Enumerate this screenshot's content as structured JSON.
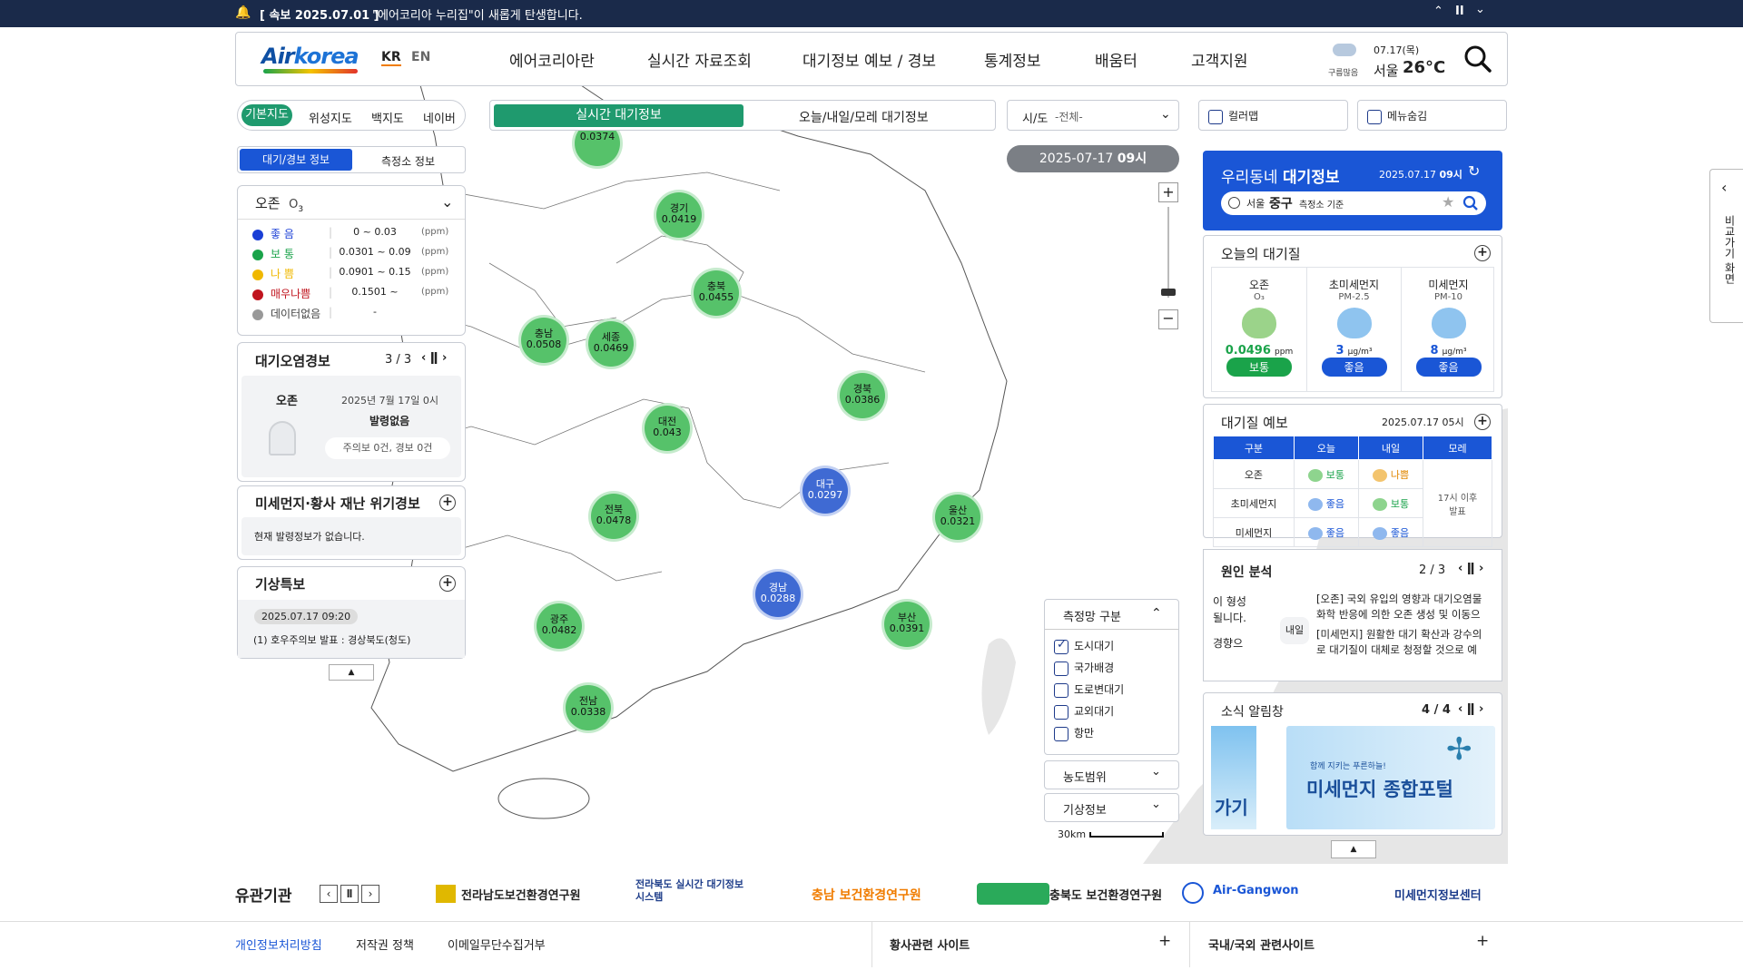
{
  "top_notice": {
    "tag": "[ 속보 2025.07.01 ]",
    "text": "\"에어코리아 누리집\"이 새롭게 탄생합니다."
  },
  "header": {
    "logo": {
      "air": "Air",
      "korea": "korea"
    },
    "lang_kr": "KR",
    "lang_en": "EN",
    "nav": [
      "에어코리아란",
      "실시간 자료조회",
      "대기정보 예보 / 경보",
      "통계정보",
      "배움터",
      "고객지원"
    ],
    "weather": {
      "date": "07.17(목)",
      "sky": "구름많음",
      "city": "서울",
      "temp": "26°C"
    }
  },
  "map_controls": {
    "base_tabs": [
      "기본지도",
      "위성지도",
      "백지도",
      "네이버"
    ],
    "info_tabs": [
      "대기/경보 정보",
      "측정소 정보"
    ],
    "center_tabs": [
      "실시간 대기정보",
      "오늘/내일/모레 대기정보"
    ],
    "sido_label": "시/도",
    "sido_value": "-전체-",
    "colormap": "컬러맵",
    "hide_menu": "메뉴숨김",
    "timestamp": "2025-07-17",
    "timestamp_hour": "09시"
  },
  "legend": {
    "title": "오존",
    "formula": "O",
    "sub": "3",
    "items": [
      {
        "label": "좋 음",
        "range": "0 ~ 0.03",
        "unit": "(ppm)",
        "color": "#1a3fd6"
      },
      {
        "label": "보 통",
        "range": "0.0301 ~ 0.09",
        "unit": "(ppm)",
        "color": "#1aa34a"
      },
      {
        "label": "나 쁨",
        "range": "0.0901 ~ 0.15",
        "unit": "(ppm)",
        "color": "#f0b800"
      },
      {
        "label": "매우나쁨",
        "range": "0.1501 ~",
        "unit": "(ppm)",
        "color": "#c0141e"
      },
      {
        "label": "데이터없음",
        "range": "-",
        "unit": "",
        "color": "#999999"
      }
    ]
  },
  "pollution_alert": {
    "title": "대기오염경보",
    "page": "3 / 3",
    "item": "오존",
    "date": "2025년 7월 17일 0시",
    "status": "발령없음",
    "counts": "주의보 0건, 경보 0건"
  },
  "dust_crisis": {
    "title": "미세먼지·황사 재난 위기경보",
    "text": "현재 발령정보가 없습니다."
  },
  "weather_alert": {
    "title": "기상특보",
    "time": "2025.07.17 09:20",
    "text": "(1) 호우주의보 발표 : 경상북도(청도)"
  },
  "markers": [
    {
      "name": "경기",
      "value": "0.0419",
      "c": "g"
    },
    {
      "name": "충북",
      "value": "0.0455",
      "c": "g"
    },
    {
      "name": "충남",
      "value": "0.0508",
      "c": "g"
    },
    {
      "name": "세종",
      "value": "0.0469",
      "c": "g"
    },
    {
      "name": "경북",
      "value": "0.0386",
      "c": "g"
    },
    {
      "name": "대전",
      "value": "0.043",
      "c": "g"
    },
    {
      "name": "대구",
      "value": "0.0297",
      "c": "b"
    },
    {
      "name": "전북",
      "value": "0.0478",
      "c": "g"
    },
    {
      "name": "울산",
      "value": "0.0321",
      "c": "g"
    },
    {
      "name": "경남",
      "value": "0.0288",
      "c": "b"
    },
    {
      "name": "부산",
      "value": "0.0391",
      "c": "g"
    },
    {
      "name": "광주",
      "value": "0.0482",
      "c": "g"
    },
    {
      "name": "전남",
      "value": "0.0338",
      "c": "g"
    },
    {
      "name": "",
      "value": "0.0374",
      "c": "g"
    }
  ],
  "network": {
    "title": "측정망 구분",
    "items": [
      {
        "label": "도시대기",
        "checked": true
      },
      {
        "label": "국가배경",
        "checked": false
      },
      {
        "label": "도로변대기",
        "checked": false
      },
      {
        "label": "교외대기",
        "checked": false
      },
      {
        "label": "항만",
        "checked": false
      }
    ],
    "range": "농도범위",
    "weather": "기상정보",
    "scale": "30km"
  },
  "side": {
    "tab": "비교가기 화면"
  },
  "right": {
    "local": {
      "title_a": "우리동네 ",
      "title_b": "대기정보",
      "date": "2025.07.17",
      "hour": "09시",
      "city": "서울",
      "district": "중구",
      "suffix": "측정소 기준"
    },
    "today": {
      "title": "오늘의 대기질",
      "cols": [
        {
          "name": "오존",
          "sub": "O₃",
          "value": "0.0496",
          "unit": "ppm",
          "grade": "보통",
          "color": "#1aa34a"
        },
        {
          "name": "초미세먼지",
          "sub": "PM-2.5",
          "value": "3",
          "unit": "μg/m³",
          "grade": "좋음",
          "color": "#1a56d6"
        },
        {
          "name": "미세먼지",
          "sub": "PM-10",
          "value": "8",
          "unit": "μg/m³",
          "grade": "좋음",
          "color": "#1a56d6"
        }
      ]
    },
    "forecast": {
      "title": "대기질 예보",
      "date": "2025.07.17 05시",
      "head": [
        "구분",
        "오늘",
        "내일",
        "모레"
      ],
      "rows": [
        {
          "k": "오존",
          "a": "보통",
          "b": "나쁨"
        },
        {
          "k": "초미세먼지",
          "a": "좋음",
          "b": "보통"
        },
        {
          "k": "미세먼지",
          "a": "좋음",
          "b": "좋음"
        }
      ],
      "later": "17시 이후 발표"
    },
    "cause": {
      "title": "원인 분석",
      "page": "2 / 3",
      "left1": "이 형성",
      "left2": "될니다.",
      "left3": "경향으",
      "tag": "내일",
      "r1": "[오존] 국외 유입의 영향과 대기오염물",
      "r2": "화학 반응에 의한 오존 생성 및 이동으",
      "r3": "[미세먼지] 원활한 대기 확산과 강수의",
      "r4": "로 대기질이 대체로 청정할 것으로 예"
    },
    "news": {
      "title": "소식 알림창",
      "page": "4 / 4",
      "banner_sub": "함께 지키는 푸른하늘!",
      "banner": "미세먼지 종합포털",
      "partial": "가기"
    }
  },
  "partners": {
    "title": "유관기관",
    "items": [
      "전라남도보건환경연구원",
      "전라북도 실시간 대기정보 시스템",
      "충남 보건환경연구원",
      "충북도 보건환경연구원",
      "Air-Gangwon",
      "미세먼지정보센터"
    ]
  },
  "footer": {
    "links": [
      "개인정보처리방침",
      "저작권 정책",
      "이메일무단수집거부"
    ],
    "sites": [
      "황사관련 사이트",
      "국내/국외 관련사이트"
    ]
  }
}
